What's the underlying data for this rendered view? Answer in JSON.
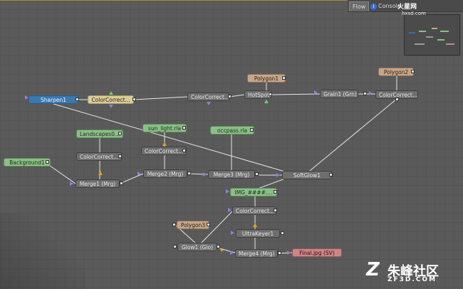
{
  "tabs": {
    "flow": "Flow",
    "console": "Console"
  },
  "watermarks": {
    "top_main": "火星网",
    "top_sub": "hxsd.com",
    "bottom_cn": "朱峰社区",
    "bottom_en": "ZF3D.COM"
  },
  "nodes": {
    "sharpen1": "Sharpen1",
    "colorcorrect_a": "ColorCorrect...",
    "colorcorrect_b": "ColorCorrect...",
    "polygon1": "Polygon1",
    "hotspot1": "HotSpot1",
    "grain1": "Grain1 (Grn)",
    "polygon2": "Polygon2",
    "colorcorrect_c": "ColorCorrect...",
    "landscapes0": "Landscapes0...",
    "sun_light": "sun_light.rla",
    "occpass": "occpass.rla",
    "colorcorrect_d": "ColorCorrect...",
    "colorcorrect_e": "ColorCorrect...",
    "background1": "Background1",
    "merge1": "Merge1 (Mrg)",
    "merge2": "Merge2 (Mrg)",
    "merge3": "Merge3 (Mrg)",
    "softglow1": "SoftGlow1",
    "img": "IMG_####....",
    "colorcorrect_f": "ColorCorrect...",
    "polygon3": "Polygon3",
    "ultrakeyer1": "UltraKeyer1",
    "glow1": "Glow1 (Glo)",
    "merge4": "Merge4 (Mrg)",
    "final": "Final.jpg (SV)"
  }
}
